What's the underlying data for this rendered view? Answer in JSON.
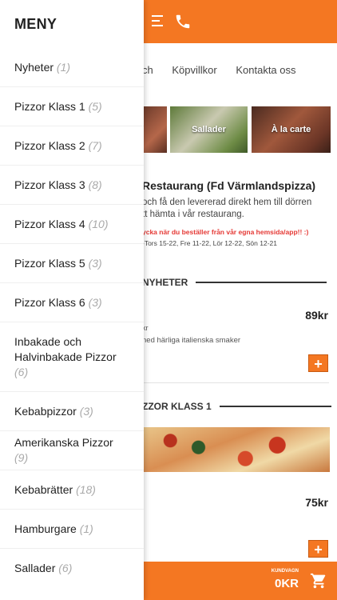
{
  "header": {
    "menu_icon": "hamburger-icon",
    "phone_icon": "phone-icon",
    "brand_color": "#f47722"
  },
  "nav": {
    "links": [
      "ch",
      "Köpvillkor",
      "Kontakta oss"
    ]
  },
  "tiles": [
    {
      "label": ""
    },
    {
      "label": "Sallader"
    },
    {
      "label": "À la carte"
    }
  ],
  "restaurant": {
    "title": "Restaurang (Fd Värmlandspizza)",
    "desc_line1": "och få den levererad direkt hem till dörren",
    "desc_line2": "tt hämta i vår restaurang.",
    "promo": "ycka när du beställer från vår egna hemsida/app!! :)",
    "hours": "-Tors 15-22, Fre 11-22, Lör 12-22, Sön 12-21",
    "promo_color": "#e53935"
  },
  "sections": [
    {
      "heading": "NYHETER"
    },
    {
      "heading": "ZZOR KLASS 1"
    }
  ],
  "items": [
    {
      "price": "89kr",
      "sub": "kr",
      "desc": "ned härliga italienska smaker",
      "add_label": "+"
    },
    {
      "price": "75kr",
      "add_label": "+"
    }
  ],
  "cart": {
    "label": "KUNDVAGN",
    "total": "0KR",
    "icon": "cart-icon"
  },
  "drawer": {
    "title": "MENY",
    "items": [
      {
        "label": "Nyheter",
        "count": "(1)"
      },
      {
        "label": "Pizzor Klass 1",
        "count": "(5)"
      },
      {
        "label": "Pizzor Klass 2",
        "count": "(7)"
      },
      {
        "label": "Pizzor Klass 3",
        "count": "(8)"
      },
      {
        "label": "Pizzor Klass 4",
        "count": "(10)"
      },
      {
        "label": "Pizzor Klass 5",
        "count": "(3)"
      },
      {
        "label": "Pizzor Klass 6",
        "count": "(3)"
      },
      {
        "label": "Inbakade och Halvinbakade Pizzor",
        "count": "(6)"
      },
      {
        "label": "Kebabpizzor",
        "count": "(3)"
      },
      {
        "label": "Amerikanska Pizzor",
        "count": "(9)"
      },
      {
        "label": "Kebabrätter",
        "count": "(18)"
      },
      {
        "label": "Hamburgare",
        "count": "(1)"
      },
      {
        "label": "Sallader",
        "count": "(6)"
      }
    ]
  }
}
